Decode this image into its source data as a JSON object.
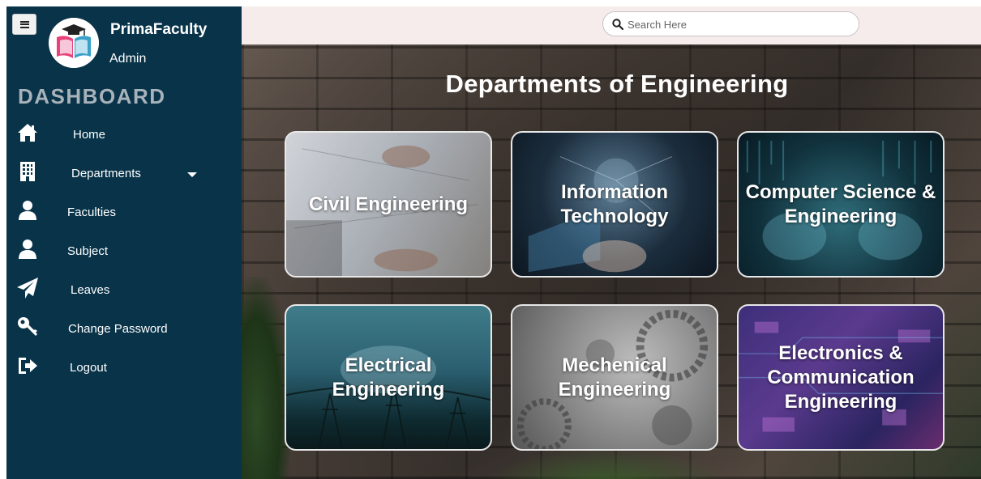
{
  "sidebar": {
    "brand_name": "PrimaFaculty",
    "brand_role": "Admin",
    "dashboard_title": "DASHBOARD",
    "items": [
      {
        "label": "Home",
        "icon": "home-icon"
      },
      {
        "label": "Departments",
        "icon": "building-icon",
        "has_dropdown": true
      },
      {
        "label": "Faculties",
        "icon": "user-icon"
      },
      {
        "label": "Subject",
        "icon": "user-icon"
      },
      {
        "label": "Leaves",
        "icon": "paper-plane-icon"
      },
      {
        "label": "Change Password",
        "icon": "key-icon"
      },
      {
        "label": "Logout",
        "icon": "sign-out-icon"
      }
    ]
  },
  "search": {
    "placeholder": "Search Here",
    "value": ""
  },
  "main": {
    "title": "Departments of Engineering",
    "departments": [
      {
        "label_lines": [
          "Civil Engineering"
        ]
      },
      {
        "label_lines": [
          "Information",
          "Technology"
        ]
      },
      {
        "label_lines": [
          "Computer Science &",
          "Engineering"
        ]
      },
      {
        "label_lines": [
          "Electrical Engineering"
        ]
      },
      {
        "label_lines": [
          "Mechenical",
          "Engineering"
        ]
      },
      {
        "label_lines": [
          "Electronics &",
          "Communication",
          "Engineering"
        ]
      }
    ]
  },
  "colors": {
    "sidebar_bg": "#083349",
    "topbar_bg": "#f6ecec",
    "dashboard_title": "#a8b2ba",
    "card_border": "#e8e8e8"
  }
}
